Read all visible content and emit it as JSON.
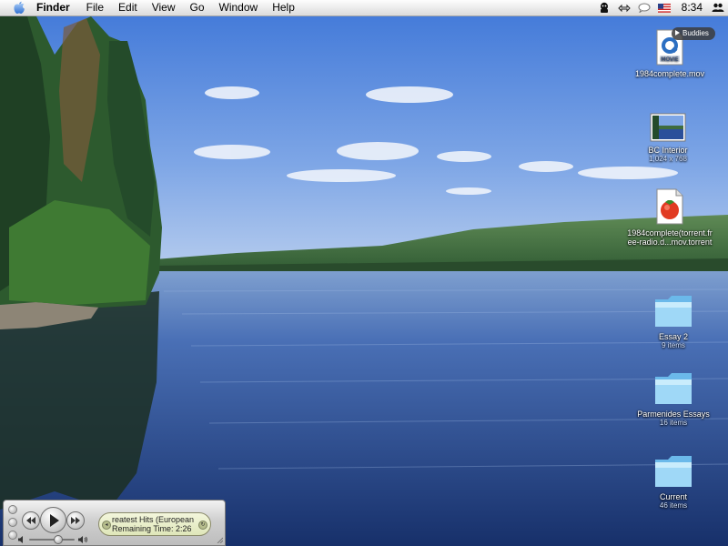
{
  "menubar": {
    "apple_icon": "apple-icon",
    "app_name": "Finder",
    "items": [
      "File",
      "Edit",
      "View",
      "Go",
      "Window",
      "Help"
    ],
    "status_icons": [
      "ichat-icon",
      "sync-arrows-icon",
      "speech-bubble-icon",
      "us-flag-icon"
    ],
    "clock": "8:34",
    "user_icon": "users-icon"
  },
  "desktop": {
    "buddies_label": "Buddies",
    "icons": [
      {
        "name": "1984complete.mov",
        "kind": "movie",
        "badge": "MOVIE"
      },
      {
        "name": "BC Interior",
        "sub": "1,024 x 768",
        "kind": "image"
      },
      {
        "name_line1": "1984complete(torrent.fr",
        "name_line2": "ee-radio.d...mov.torrent",
        "kind": "torrent"
      },
      {
        "name": "Essay 2",
        "sub": "9 items",
        "kind": "folder"
      },
      {
        "name": "Parmenides Essays",
        "sub": "16 items",
        "kind": "folder"
      },
      {
        "name": "Current",
        "sub": "46 items",
        "kind": "folder"
      }
    ]
  },
  "player": {
    "track_title": "reatest Hits (European",
    "remaining": "Remaining Time: 2:26",
    "volume_fraction": 0.62
  },
  "colors": {
    "sky": "#6f9be3",
    "water": "#2b4f9a",
    "folder": "#8fd0f5",
    "lcd": "#e6ecc4"
  }
}
